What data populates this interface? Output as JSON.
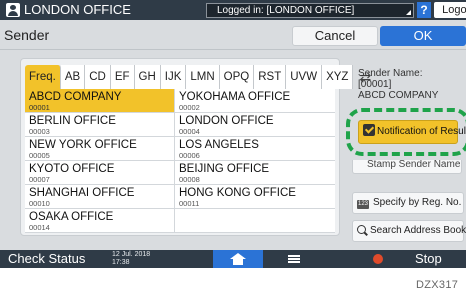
{
  "topbar": {
    "office_name": "LONDON OFFICE",
    "login_status": "Logged in: [LONDON OFFICE]",
    "help_label": "?",
    "logout_label": "Logout"
  },
  "header": {
    "title": "Sender",
    "cancel_label": "Cancel",
    "ok_label": "OK"
  },
  "tabs": [
    "Freq.",
    "AB",
    "CD",
    "EF",
    "GH",
    "IJK",
    "LMN",
    "OPQ",
    "RST",
    "UVW",
    "XYZ"
  ],
  "entries": [
    {
      "name": "ABCD COMPANY",
      "number": "00001",
      "selected": true
    },
    {
      "name": "YOKOHAMA OFFICE",
      "number": "00002"
    },
    {
      "name": "BERLIN OFFICE",
      "number": "00003"
    },
    {
      "name": "LONDON OFFICE",
      "number": "00004"
    },
    {
      "name": "NEW YORK OFFICE",
      "number": "00005"
    },
    {
      "name": "LOS ANGELES",
      "number": "00006"
    },
    {
      "name": "KYOTO OFFICE",
      "number": "00007"
    },
    {
      "name": "BEIJING OFFICE",
      "number": "00008"
    },
    {
      "name": "SHANGHAI  OFFICE",
      "number": "00010"
    },
    {
      "name": "HONG KONG OFFICE",
      "number": "00011"
    },
    {
      "name": "OSAKA OFFICE",
      "number": "00014"
    }
  ],
  "sender_info": {
    "label": "Sender Name:",
    "number": "[00001]",
    "name": "ABCD COMPANY"
  },
  "buttons": {
    "notification": "Notification of Result",
    "stamp": "Stamp Sender Name",
    "reg_no": "Specify by Reg. No.",
    "reg_icon": "123",
    "search": "Search Address Book"
  },
  "bottombar": {
    "status_label": "Check Status",
    "date": "12 Jul. 2018",
    "time": "17:38",
    "stop_label": "Stop"
  },
  "figure_id": "DZX317",
  "colors": {
    "accent": "#f2c22a",
    "primary": "#2b73d6",
    "dark_bar": "#2f3b47",
    "highlight": "#1fa34a"
  }
}
